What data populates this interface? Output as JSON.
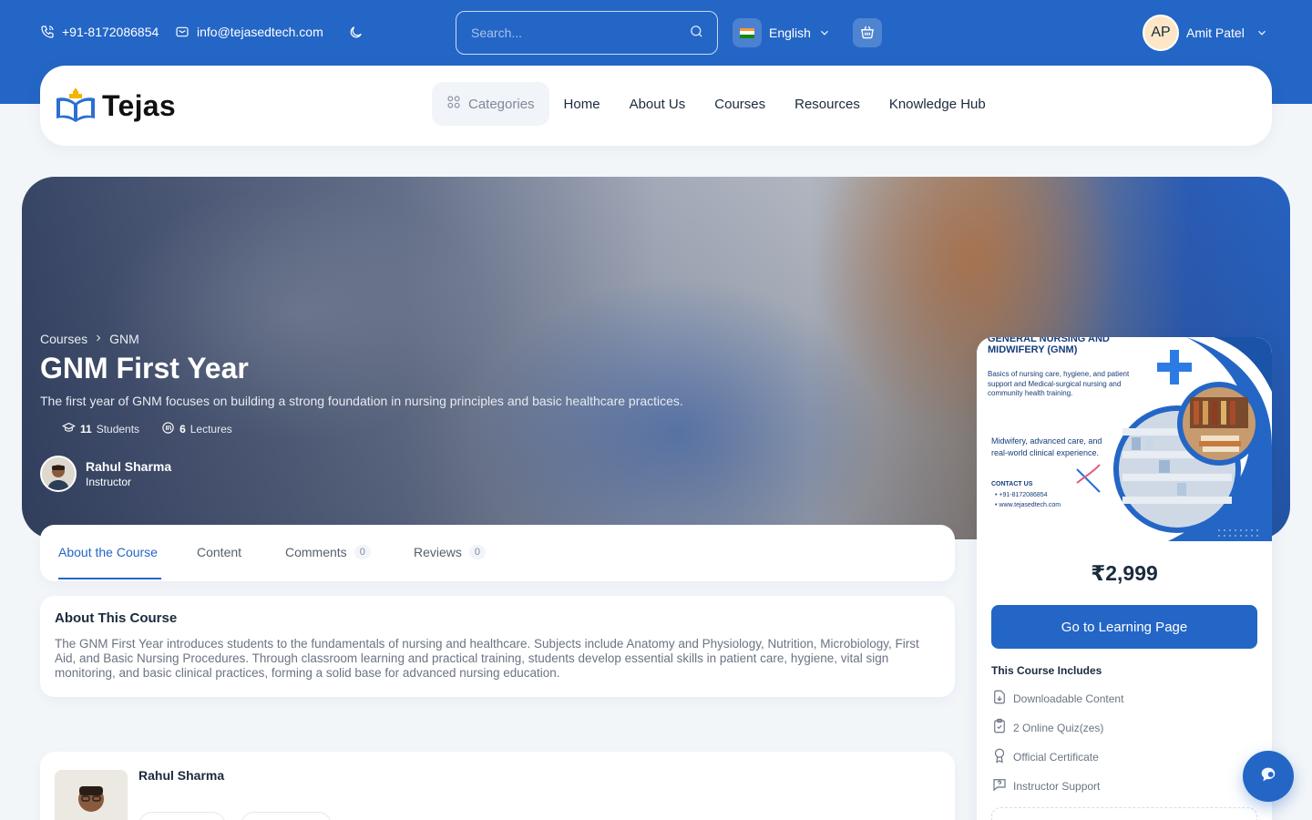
{
  "topbar": {
    "phone": "+91-8172086854",
    "email": "info@tejasedtech.com",
    "search_placeholder": "Search...",
    "language": "English",
    "user_initials": "AP",
    "user_name": "Amit Patel"
  },
  "nav": {
    "logo_text": "Tejas",
    "categories": "Categories",
    "links": [
      "Home",
      "About Us",
      "Courses",
      "Resources",
      "Knowledge Hub"
    ]
  },
  "hero": {
    "breadcrumb": [
      "Courses",
      "GNM"
    ],
    "title": "GNM First Year",
    "description": "The first year of GNM focuses on building a strong foundation in nursing principles and basic healthcare practices.",
    "students_count": "11",
    "students_label": "Students",
    "lectures_count": "6",
    "lectures_label": "Lectures",
    "instructor_name": "Rahul Sharma",
    "instructor_role": "Instructor"
  },
  "tabs": [
    {
      "label": "About the Course",
      "count": null
    },
    {
      "label": "Content",
      "count": null
    },
    {
      "label": "Comments",
      "count": "0"
    },
    {
      "label": "Reviews",
      "count": "0"
    }
  ],
  "about": {
    "title": "About This Course",
    "text": "The GNM First Year introduces students to the fundamentals of nursing and healthcare. Subjects include Anatomy and Physiology, Nutrition, Microbiology, First Aid, and Basic Nursing Procedures. Through classroom learning and practical training, students develop essential skills in patient care, hygiene, vital sign monitoring, and basic clinical practices, forming a solid base for advanced nursing education."
  },
  "instructor_card": {
    "name": "Rahul Sharma"
  },
  "sidebar": {
    "thumb_heading": "GENERAL NURSING AND MIDWIFERY (GNM)",
    "thumb_text1": "Basics of nursing care, hygiene, and patient support and Medical-surgical nursing and community health training.",
    "thumb_text2": "Midwifery, advanced care, and real-world clinical experience.",
    "thumb_contact": "CONTACT US",
    "thumb_phone": "+91-8172086854",
    "thumb_web": "www.tejasedtech.com",
    "price": "₹2,999",
    "cta": "Go to Learning Page",
    "includes_title": "This Course Includes",
    "includes": [
      "Downloadable Content",
      "2 Online Quiz(zes)",
      "Official Certificate",
      "Instructor Support"
    ]
  },
  "colors": {
    "brand_blue": "#2466c6",
    "text_dark": "#1b2a3d",
    "text_muted": "#6b7483"
  },
  "icons": [
    "phone-icon",
    "mail-icon",
    "moon-icon",
    "search-icon",
    "india-flag-icon",
    "chevron-down-icon",
    "cart-icon",
    "grid-icon",
    "chevron-right-icon",
    "students-icon",
    "lectures-icon",
    "download-icon",
    "quiz-icon",
    "certificate-icon",
    "support-icon",
    "chat-icon"
  ]
}
